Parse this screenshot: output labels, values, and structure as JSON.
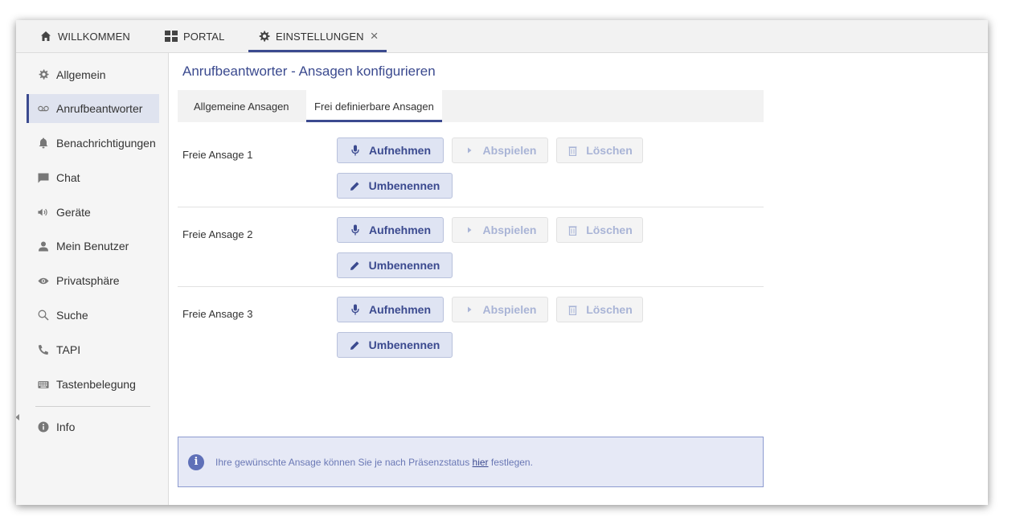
{
  "tabs": [
    {
      "label": "WILLKOMMEN",
      "icon": "home-icon"
    },
    {
      "label": "PORTAL",
      "icon": "grid-icon"
    },
    {
      "label": "EINSTELLUNGEN",
      "icon": "gear-icon",
      "active": true,
      "closable": true
    }
  ],
  "close_symbol": "×",
  "sidebar": {
    "items": [
      {
        "label": "Allgemein",
        "icon": "gear-icon"
      },
      {
        "label": "Anrufbeantworter",
        "icon": "voicemail-icon",
        "active": true
      },
      {
        "label": "Benachrichtigungen",
        "icon": "bell-icon"
      },
      {
        "label": "Chat",
        "icon": "chat-icon"
      },
      {
        "label": "Geräte",
        "icon": "speaker-icon"
      },
      {
        "label": "Mein Benutzer",
        "icon": "user-icon"
      },
      {
        "label": "Privatsphäre",
        "icon": "eye-icon"
      },
      {
        "label": "Suche",
        "icon": "search-icon"
      },
      {
        "label": "TAPI",
        "icon": "phone-icon"
      },
      {
        "label": "Tastenbelegung",
        "icon": "keyboard-icon"
      },
      {
        "label": "Info",
        "icon": "info-icon"
      }
    ]
  },
  "main": {
    "title": "Anrufbeantworter - Ansagen konfigurieren",
    "subtabs": [
      {
        "label": "Allgemeine Ansagen"
      },
      {
        "label": "Frei definierbare Ansagen",
        "active": true
      }
    ],
    "rows": [
      {
        "label": "Freie Ansage 1"
      },
      {
        "label": "Freie Ansage 2"
      },
      {
        "label": "Freie Ansage 3"
      }
    ],
    "buttons": {
      "record": "Aufnehmen",
      "play": "Abspielen",
      "delete": "Löschen",
      "rename": "Umbenennen"
    },
    "info": {
      "text_before": "Ihre gewünschte Ansage können Sie je nach Präsenzstatus ",
      "link": "hier",
      "text_after": " festlegen."
    }
  },
  "colors": {
    "accent": "#3b4a8f",
    "button_bg": "#dfe4f3",
    "disabled_text": "#a9b4d6",
    "info_bg": "#e6e9f6"
  }
}
